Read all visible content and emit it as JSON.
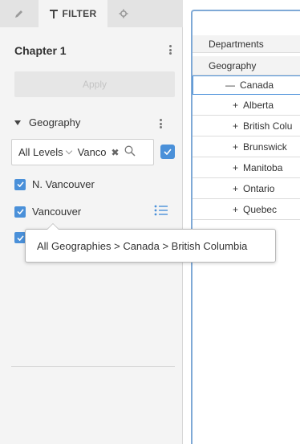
{
  "tabs": {
    "edit_icon": "pencil-icon",
    "filter_label": "FILTER",
    "filter_icon": "funnel-icon",
    "settings_icon": "gear-icon"
  },
  "panel": {
    "chapter_title": "Chapter 1",
    "apply_label": "Apply",
    "filter_name": "Geography",
    "search": {
      "levels_label": "All Levels",
      "value": "Vanco"
    },
    "items": [
      {
        "label": "N. Vancouver",
        "checked": true
      },
      {
        "label": "Vancouver",
        "checked": true
      },
      {
        "label": "",
        "checked": true
      }
    ],
    "tooltip": "All Geographies > Canada > British Columbia"
  },
  "grid": {
    "rows": [
      {
        "prefix": "",
        "label": "Departments"
      },
      {
        "prefix": "",
        "label": "Geography"
      },
      {
        "prefix": "—",
        "label": "Canada"
      },
      {
        "prefix": "+",
        "label": "Alberta"
      },
      {
        "prefix": "+",
        "label": "British Colu"
      },
      {
        "prefix": "+",
        "label": "Brunswick"
      },
      {
        "prefix": "+",
        "label": "Manitoba"
      },
      {
        "prefix": "+",
        "label": "Ontario"
      },
      {
        "prefix": "+",
        "label": "Quebec"
      }
    ]
  },
  "colors": {
    "accent": "#4a90d9",
    "grid_border": "#7fa9d6"
  }
}
